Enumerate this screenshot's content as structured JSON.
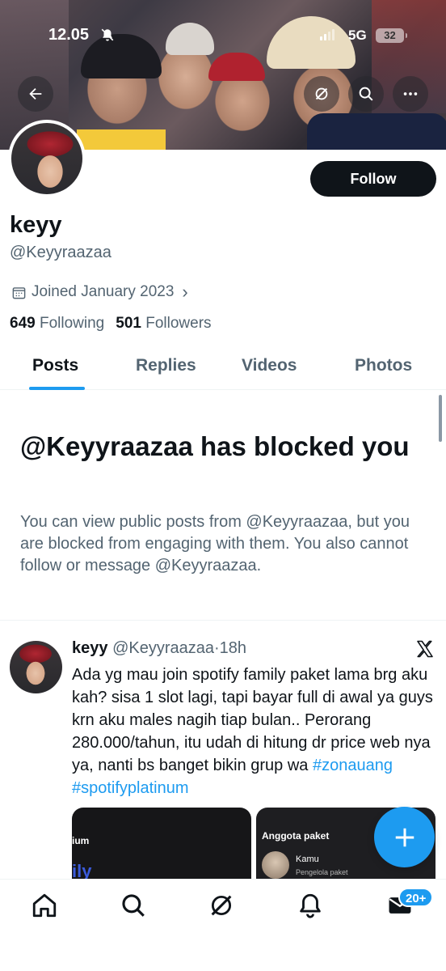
{
  "status_bar": {
    "time": "12.05",
    "network": "5G",
    "battery": "32"
  },
  "profile": {
    "name": "keyy",
    "handle": "@Keyyraazaa",
    "joined": "Joined January 2023",
    "following_count": "649",
    "following_label": "Following",
    "followers_count": "501",
    "followers_label": "Followers",
    "follow_label": "Follow"
  },
  "tabs": [
    {
      "label": "Posts",
      "active": true
    },
    {
      "label": "Replies",
      "active": false
    },
    {
      "label": "Videos",
      "active": false
    },
    {
      "label": "Photos",
      "active": false
    }
  ],
  "blocked": {
    "title": "@Keyyraazaa has blocked you",
    "description": "You can view public posts from @Keyyraazaa, but you are blocked from engaging with them. You also cannot follow or message @Keyyraazaa."
  },
  "post": {
    "author_name": "keyy",
    "author_handle": "@Keyyraazaa",
    "separator": "·",
    "time": "18h",
    "text": "Ada yg mau join spotify family paket lama brg aku kah? sisa 1 slot lagi, tapi bayar full di awal ya guys krn aku males nagih tiap bulan.. Perorang 280.000/tahun, itu udah di hitung dr price web nya ya, nanti bs banget bikin grup wa",
    "hashtags": [
      "#zonauang",
      "#spotifyplatinum"
    ],
    "media": [
      {
        "title": "ium",
        "subtitle": "ily"
      },
      {
        "title": "Anggota paket",
        "member_name": "Kamu",
        "member_role": "Pengelola paket"
      }
    ]
  },
  "bottom_nav": {
    "items": [
      "home",
      "search",
      "grok",
      "notifications",
      "messages"
    ],
    "messages_badge": "20+"
  },
  "colors": {
    "accent": "#1d9bf0",
    "text_primary": "#0f1419",
    "text_secondary": "#536471",
    "follow_button": "#0f1419"
  }
}
